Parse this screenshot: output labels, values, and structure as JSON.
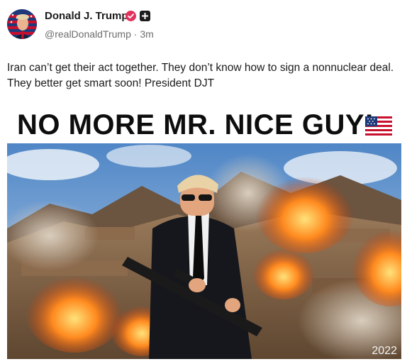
{
  "post": {
    "author": {
      "display_name": "Donald J. Trump",
      "handle": "@realDonaldTrump",
      "separator": "·",
      "time_ago": "3m",
      "avatar_icon": "flag-portrait-avatar",
      "verified_icon": "verified-check-icon",
      "badge_icon": "plus-badge-icon",
      "verified_color": "#e3315c"
    },
    "text": "Iran can’t get their act together. They don’t know how to sign a nonnuclear deal. They better get smart soon! President DJT",
    "media": {
      "caption": "NO MORE MR. NICE GUY!",
      "caption_emoji": "us-flag-icon",
      "watermark": "2022"
    }
  }
}
